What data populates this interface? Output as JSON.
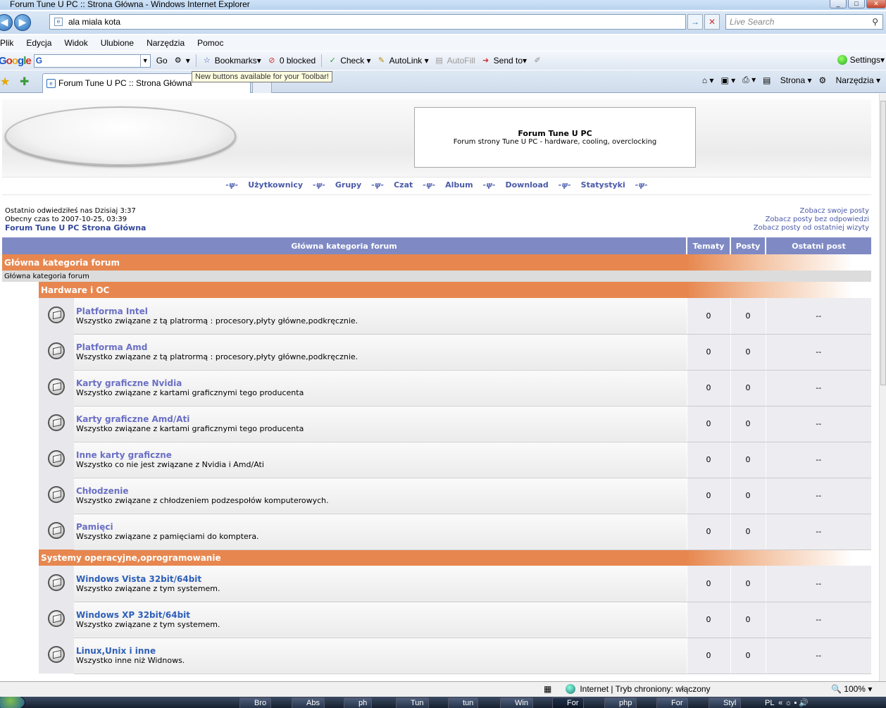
{
  "window": {
    "title": "Forum Tune U PC :: Strona Główna - Windows Internet Explorer"
  },
  "address": {
    "value": "ala miala kota"
  },
  "search": {
    "placeholder": "Live Search"
  },
  "menu": [
    "Plik",
    "Edycja",
    "Widok",
    "Ulubione",
    "Narzędzia",
    "Pomoc"
  ],
  "google_toolbar": {
    "logo": "Google",
    "go": "Go",
    "bookmarks": "Bookmarks",
    "blocked": "0 blocked",
    "check": "Check",
    "autolink": "AutoLink",
    "autofill": "AutoFill",
    "sendto": "Send to",
    "settings": "Settings"
  },
  "tooltip": "New buttons available for your Toolbar!",
  "tab": {
    "title": "Forum Tune U PC :: Strona Główna"
  },
  "commandbar": {
    "strona": "Strona",
    "narzedzia": "Narzędzia"
  },
  "site": {
    "title": "Forum Tune U PC",
    "subtitle": "Forum strony Tune U PC - hardware, cooling, overclocking"
  },
  "nav": [
    "Użytkownicy",
    "Grupy",
    "Czat",
    "Album",
    "Download",
    "Statystyki"
  ],
  "info": {
    "last_visit": "Ostatnio odwiedziłeś nas Dzisiaj 3:37",
    "current_time": "Obecny czas to 2007-10-25, 03:39",
    "forum_link": "Forum Tune U PC Strona Główna",
    "own_posts": "Zobacz swoje posty",
    "unanswered": "Zobacz posty bez odpowiedzi",
    "since_last": "Zobacz posty od ostatniej wizyty"
  },
  "table": {
    "headers": [
      "Główna kategoria forum",
      "Tematy",
      "Posty",
      "Ostatni post"
    ],
    "category": "Główna kategoria forum",
    "subcategory": "Główna kategoria forum",
    "sections": [
      {
        "name": "Hardware i OC",
        "forums": [
          {
            "name": "Platforma Intel",
            "desc": "Wszystko związane z tą platrormą : procesory,płyty główne,podkręcznie.",
            "topics": "0",
            "posts": "0",
            "last": "--"
          },
          {
            "name": "Platforma Amd",
            "desc": "Wszystko związane z tą platrormą : procesory,płyty główne,podkręcznie.",
            "topics": "0",
            "posts": "0",
            "last": "--"
          },
          {
            "name": "Karty graficzne Nvidia",
            "desc": "Wszystko związane z kartami graficznymi tego producenta",
            "topics": "0",
            "posts": "0",
            "last": "--"
          },
          {
            "name": "Karty graficzne Amd/Ati",
            "desc": "Wszystko związane z kartami graficznymi tego producenta",
            "topics": "0",
            "posts": "0",
            "last": "--"
          },
          {
            "name": "Inne karty graficzne",
            "desc": "Wszystko co nie jest związane z Nvidia i Amd/Ati",
            "topics": "0",
            "posts": "0",
            "last": "--"
          },
          {
            "name": "Chłodzenie",
            "desc": "Wszystko związane z chłodzeniem podzespołów komputerowych.",
            "topics": "0",
            "posts": "0",
            "last": "--"
          },
          {
            "name": "Pamięci",
            "desc": "Wszystko związane z pamięciami do komptera.",
            "topics": "0",
            "posts": "0",
            "last": "--"
          }
        ]
      },
      {
        "name": "Systemy operacyjne,oprogramowanie",
        "forums": [
          {
            "name": "Windows Vista 32bit/64bit",
            "desc": "Wszystko związane z tym systemem.",
            "topics": "0",
            "posts": "0",
            "last": "--"
          },
          {
            "name": "Windows XP 32bit/64bit",
            "desc": "Wszystko związane z tym systemem.",
            "topics": "0",
            "posts": "0",
            "last": "--"
          },
          {
            "name": "Linux,Unix i inne",
            "desc": "Wszystko inne niż Widnows.",
            "topics": "0",
            "posts": "0",
            "last": "--"
          }
        ]
      }
    ]
  },
  "status": {
    "zone": "Internet | Tryb chroniony: włączony",
    "zoom": "100%"
  },
  "taskbar": [
    "Bro",
    "Abs",
    "ph",
    "Tun",
    "tun",
    "Win",
    "For",
    "php",
    "For",
    "Styl"
  ]
}
